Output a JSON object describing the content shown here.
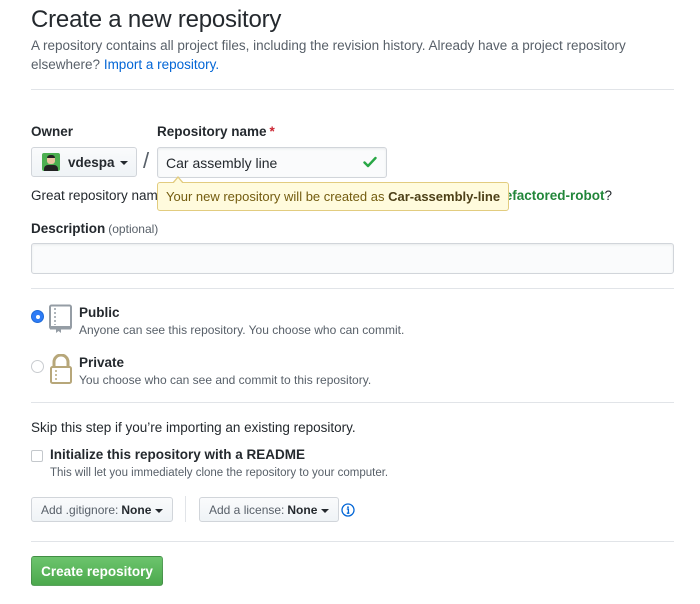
{
  "header": {
    "title": "Create a new repository",
    "subtitle": "A repository contains all project files, including the revision history. Already have a project repository elsewhere?",
    "import_link": "Import a repository."
  },
  "owner": {
    "label": "Owner",
    "value": "vdespa",
    "avatar_icon": "user-avatar"
  },
  "separator": "/",
  "repo_name": {
    "label": "Repository name",
    "required_marker": "*",
    "value": "Car assembly line",
    "status_icon": "check-icon",
    "status_color": "#28a745"
  },
  "suggestion": {
    "prefix": "Great repository nam",
    "suffix_pre": "t",
    "suggested_name": "refactored-robot",
    "suffix_post": "?"
  },
  "tooltip": {
    "text": "Your new repository will be created as",
    "normalized_name": "Car-assembly-line"
  },
  "description": {
    "label": "Description",
    "optional": "(optional)",
    "value": "",
    "placeholder": ""
  },
  "visibility": {
    "options": [
      {
        "id": "public",
        "title": "Public",
        "note": "Anyone can see this repository. You choose who can commit.",
        "icon": "repo-book-icon",
        "selected": true
      },
      {
        "id": "private",
        "title": "Private",
        "note": "You choose who can see and commit to this repository.",
        "icon": "lock-icon",
        "selected": false
      }
    ]
  },
  "init": {
    "skip_note": "Skip this step if you’re importing an existing repository.",
    "readme_label": "Initialize this repository with a README",
    "readme_note": "This will let you immediately clone the repository to your computer.",
    "readme_checked": false
  },
  "gitignore": {
    "label": "Add .gitignore:",
    "value": "None"
  },
  "license": {
    "label": "Add a license:",
    "value": "None",
    "info_icon": "info-icon"
  },
  "submit": {
    "label": "Create repository",
    "color": "#4ca94d"
  },
  "colors": {
    "link": "#0366d6",
    "required": "#cb2431",
    "radio_selected": "#2e7cf6",
    "tooltip_bg": "#fffbdd"
  }
}
